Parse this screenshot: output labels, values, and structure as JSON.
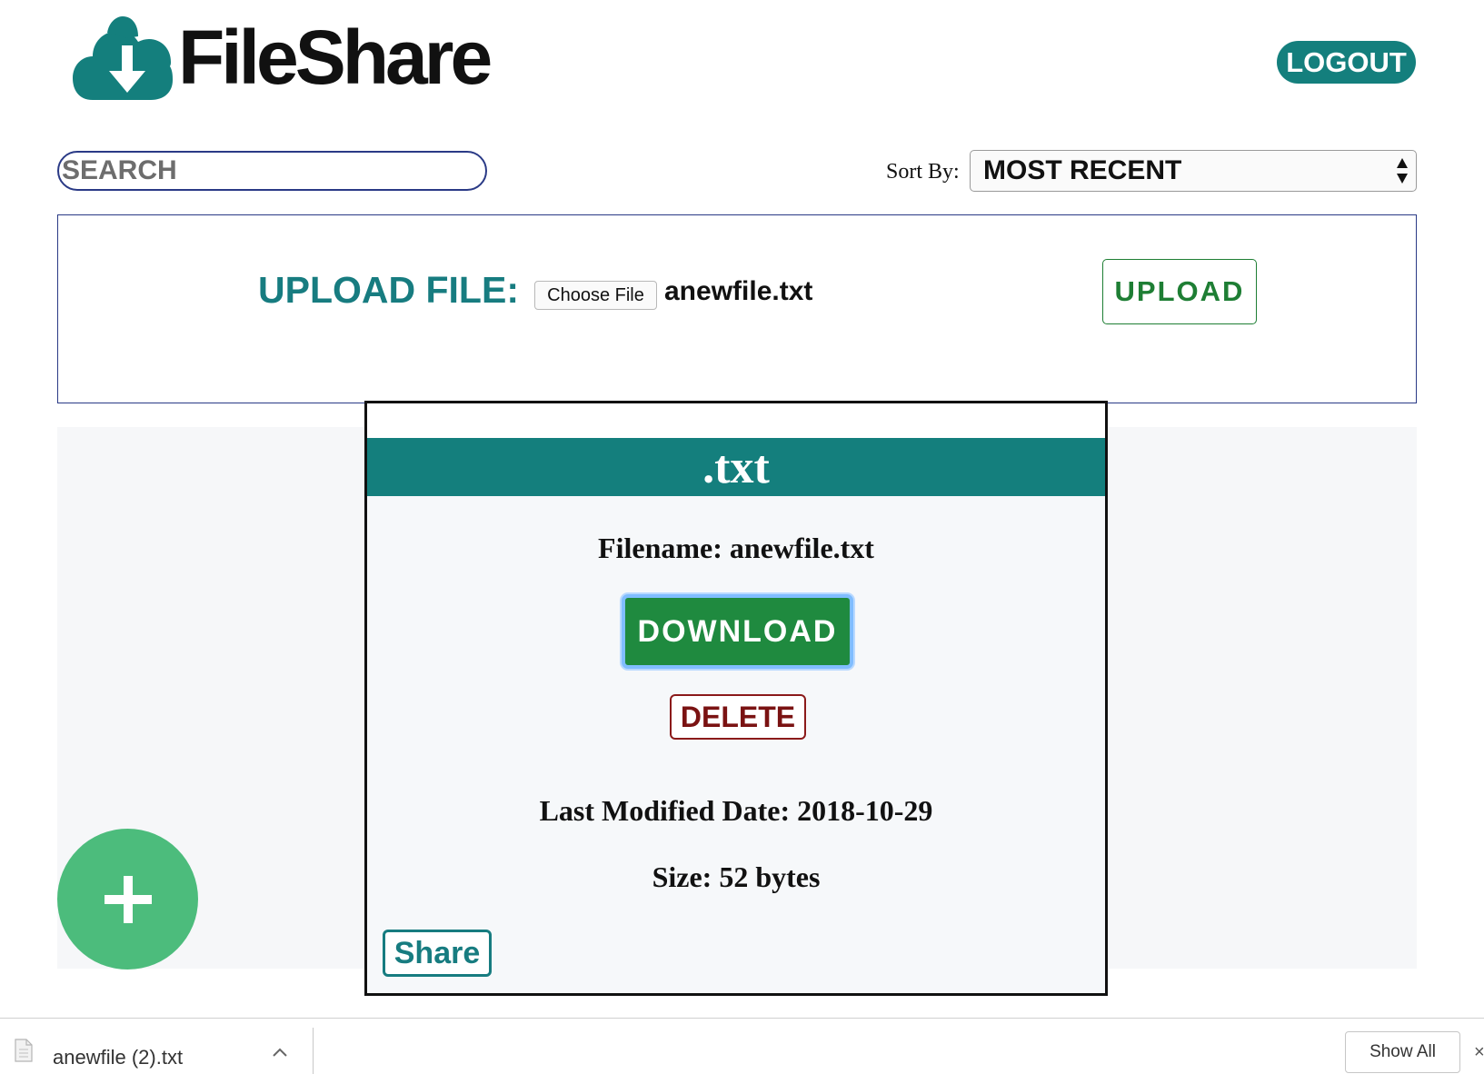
{
  "header": {
    "logo_text": "FileShare",
    "logout_label": "LOGOUT"
  },
  "toolbar": {
    "search_placeholder": "SEARCH",
    "sort_label": "Sort By:",
    "sort_selected": "MOST RECENT"
  },
  "upload": {
    "label": "UPLOAD FILE:",
    "choose_file_label": "Choose File",
    "selected_file": "anewfile.txt",
    "upload_button": "UPLOAD"
  },
  "file_card": {
    "extension": ".txt",
    "filename_line": "Filename: anewfile.txt",
    "download_label": "DOWNLOAD",
    "delete_label": "DELETE",
    "modified_line": "Last Modified Date: 2018-10-29",
    "size_line": "Size: 52 bytes",
    "share_label": "Share"
  },
  "fab": {
    "icon": "plus-icon"
  },
  "download_bar": {
    "file_name": "anewfile (2).txt",
    "show_all_label": "Show All",
    "close_glyph": "×"
  },
  "colors": {
    "brand_teal": "#147f7d",
    "upload_green": "#1e7e34",
    "download_green": "#1f8a3f",
    "delete_red": "#7a1212",
    "fab_green": "#4cbc7c",
    "border_navy": "#2a3a86"
  }
}
